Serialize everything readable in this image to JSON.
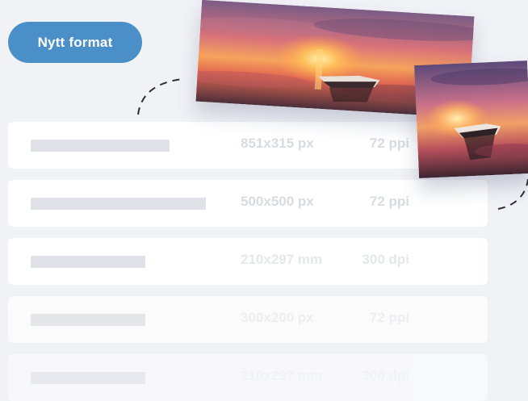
{
  "toolbar": {
    "new_format_label": "Nytt format"
  },
  "formats": [
    {
      "dimensions": "851x315 px",
      "resolution": "72 ppi"
    },
    {
      "dimensions": "500x500 px",
      "resolution": "72 ppi"
    },
    {
      "dimensions": "210x297 mm",
      "resolution": "300 dpi"
    },
    {
      "dimensions": "300x200 px",
      "resolution": "72 ppi"
    },
    {
      "dimensions": "210x297 mm",
      "resolution": "300 dpi"
    }
  ],
  "icons": {
    "banner_preview": "sunset-boat-photo",
    "square_preview": "sunset-boat-photo"
  },
  "colors": {
    "accent": "#4a8fc8",
    "background": "#f1f2f6",
    "row": "#ffffff",
    "muted_text": "#d9dbe2"
  }
}
